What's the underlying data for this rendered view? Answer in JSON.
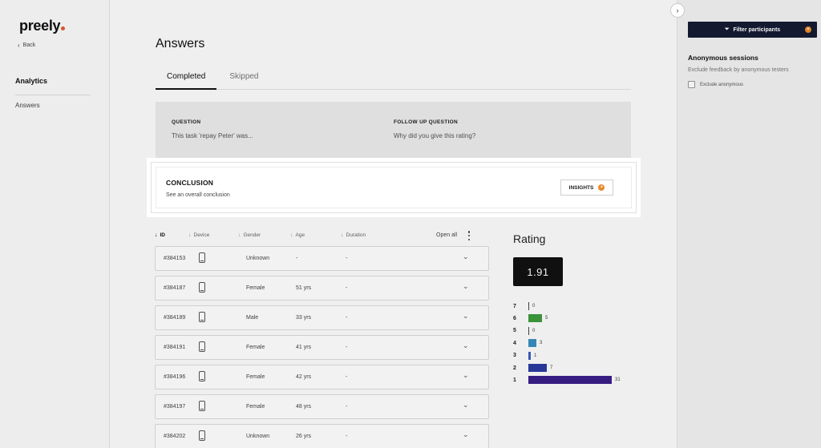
{
  "brand": {
    "name": "preely"
  },
  "sidebar": {
    "back_label": "Back",
    "section_title": "Analytics",
    "items": [
      {
        "label": "Answers"
      }
    ]
  },
  "main": {
    "title": "Answers",
    "tabs": [
      {
        "label": "Completed",
        "active": true
      },
      {
        "label": "Skipped",
        "active": false
      }
    ],
    "question": {
      "label": "QUESTION",
      "text": "This task 'repay Peter' was...",
      "followup_label": "FOLLOW UP QUESTION",
      "followup_text": "Why did you give this rating?"
    },
    "conclusion": {
      "title": "CONCLUSION",
      "subtitle": "See an overall conclusion",
      "button_label": "INSIGHTS",
      "button_badge": "+"
    },
    "table": {
      "columns": [
        "ID",
        "Device",
        "Gender",
        "Age",
        "Duration"
      ],
      "open_all_label": "Open all",
      "rows": [
        {
          "id": "#384153",
          "gender": "Unknown",
          "age": "-",
          "duration": "-"
        },
        {
          "id": "#384187",
          "gender": "Female",
          "age": "51 yrs",
          "duration": "-"
        },
        {
          "id": "#384189",
          "gender": "Male",
          "age": "33 yrs",
          "duration": "-"
        },
        {
          "id": "#384191",
          "gender": "Female",
          "age": "41 yrs",
          "duration": "-"
        },
        {
          "id": "#384196",
          "gender": "Female",
          "age": "42 yrs",
          "duration": "-"
        },
        {
          "id": "#384197",
          "gender": "Female",
          "age": "48 yrs",
          "duration": "-"
        },
        {
          "id": "#384202",
          "gender": "Unknown",
          "age": "26 yrs",
          "duration": "-"
        }
      ]
    },
    "rating": {
      "title": "Rating",
      "average": "1.91",
      "distribution": [
        {
          "score": "7",
          "count": 0,
          "label": "0",
          "color": "#444444"
        },
        {
          "score": "6",
          "count": 5,
          "label": "5",
          "color": "#3f9a3f"
        },
        {
          "score": "5",
          "count": 0,
          "label": "0",
          "color": "#444444"
        },
        {
          "score": "4",
          "count": 3,
          "label": "3",
          "color": "#3a8fc0"
        },
        {
          "score": "3",
          "count": 1,
          "label": "1",
          "color": "#3a5ec0"
        },
        {
          "score": "2",
          "count": 7,
          "label": "7",
          "color": "#2b3aa0"
        },
        {
          "score": "1",
          "count": 31,
          "label": "31",
          "color": "#3a1f8a"
        }
      ]
    }
  },
  "right_panel": {
    "toggle_icon": "›",
    "filter_label": "Filter participants",
    "filter_badge": "+",
    "anon_title": "Anonymous sessions",
    "anon_subtitle": "Exclude feedback by anonymous testers",
    "anon_checkbox_label": "Exclude anonymous"
  }
}
